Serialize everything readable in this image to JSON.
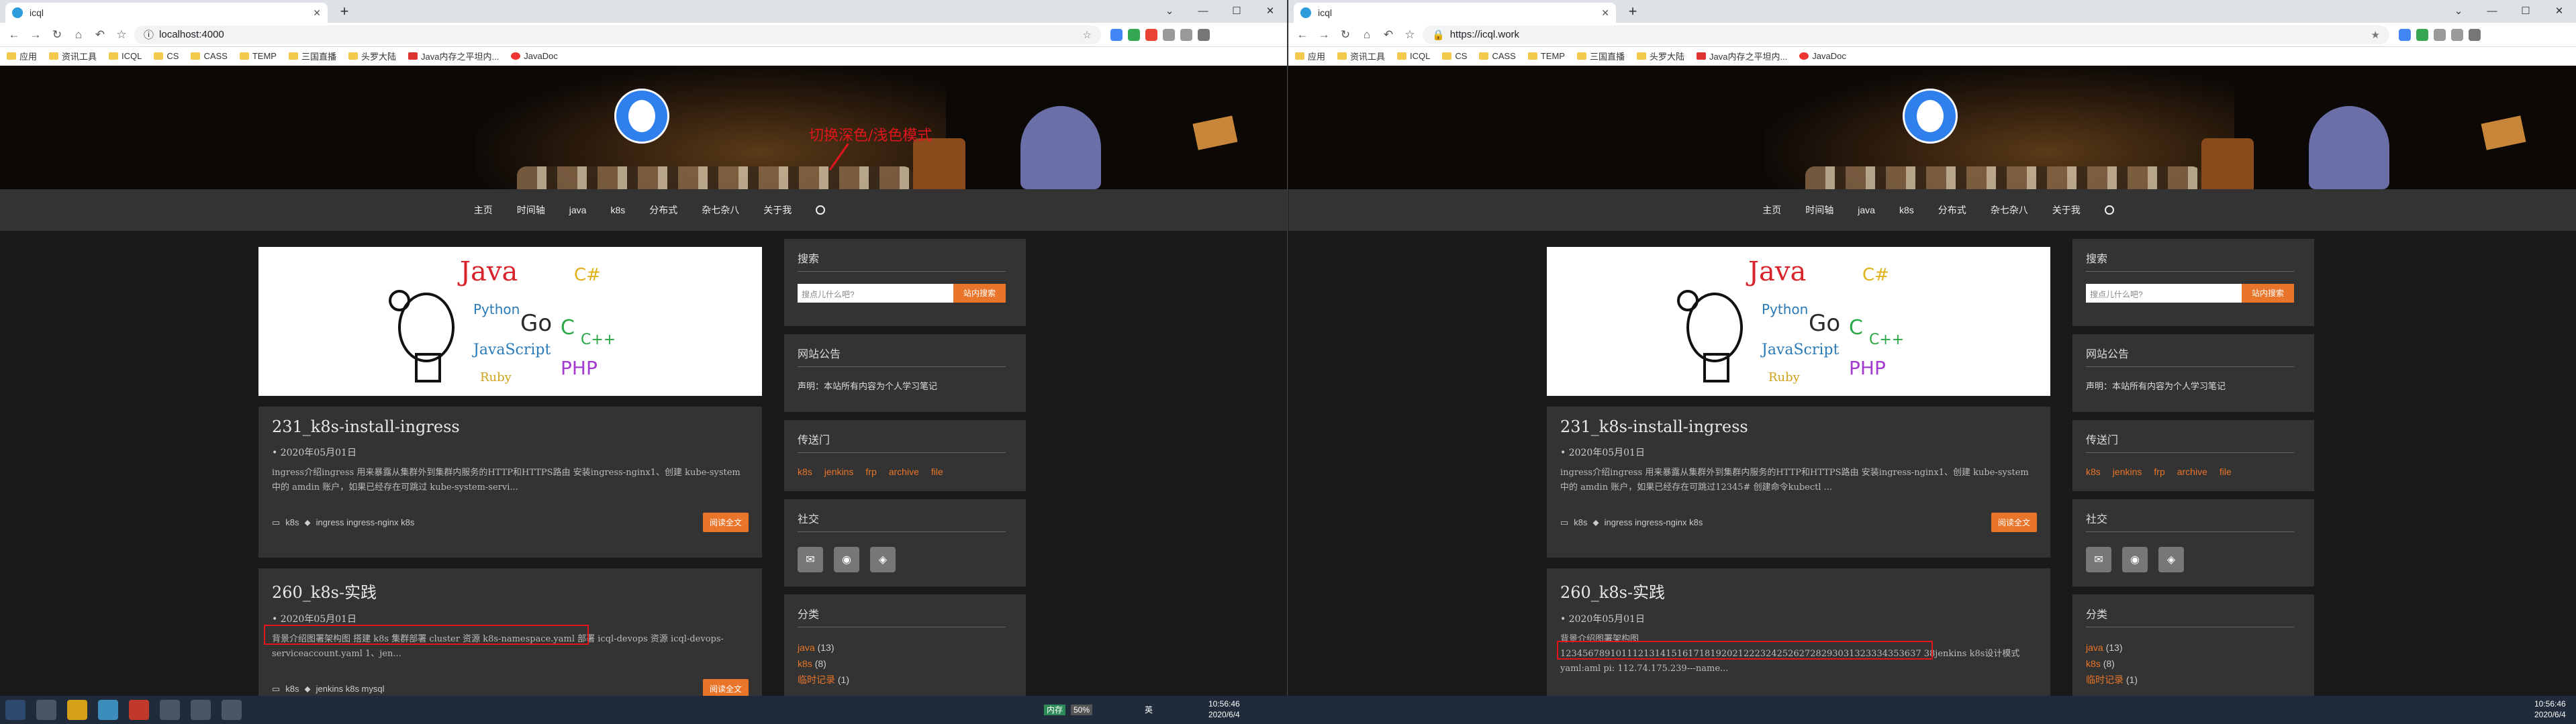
{
  "windows": [
    {
      "tab_title": "icql",
      "url": "localhost:4000",
      "bookmarks": [
        "应用",
        "资讯工具",
        "ICQL",
        "CS",
        "CASS",
        "TEMP",
        "三国直播",
        "头罗大陆",
        "Java内存之平坦内...",
        "JavaDoc"
      ],
      "annotation": "切换深色/浅色模式",
      "nav": [
        "主页",
        "时间轴",
        "java",
        "k8s",
        "分布式",
        "杂七杂八",
        "关于我"
      ],
      "posts": [
        {
          "title": "231_k8s-install-ingress",
          "date": "• 2020年05月01日",
          "excerpt": "ingress介绍ingress 用来暴露从集群外到集群内服务的HTTP和HTTPS路由 安装ingress-nginx1、创建 kube-system 中的 amdin 账户，如果已经存在可跳过 kube-system-servi...",
          "category": "k8s",
          "tags": "ingress  ingress-nginx  k8s",
          "read": "阅读全文"
        },
        {
          "title": "260_k8s-实践",
          "date": "• 2020年05月01日",
          "excerpt": "背景介绍图署架构图 搭建 k8s 集群部署 cluster 资源 k8s-namespace.yaml 部署 icql-devops 资源 icql-devops-serviceaccount.yaml 1、jen...",
          "category": "k8s",
          "tags": "jenkins  k8s  mysql",
          "read": "阅读全文"
        }
      ]
    },
    {
      "tab_title": "icql",
      "url": "https://icql.work",
      "bookmarks": [
        "应用",
        "资讯工具",
        "ICQL",
        "CS",
        "CASS",
        "TEMP",
        "三国直播",
        "头罗大陆",
        "Java内存之平坦内...",
        "JavaDoc"
      ],
      "annotation": "",
      "nav": [
        "主页",
        "时间轴",
        "java",
        "k8s",
        "分布式",
        "杂七杂八",
        "关于我"
      ],
      "posts": [
        {
          "title": "231_k8s-install-ingress",
          "date": "• 2020年05月01日",
          "excerpt": "ingress介绍ingress 用来暴露从集群外到集群内服务的HTTP和HTTPS路由 安装ingress-nginx1、创建 kube-system 中的 amdin 账户，如果已经存在可跳过12345# 创建命令kubectl ...",
          "category": "k8s",
          "tags": "ingress  ingress-nginx  k8s",
          "read": "阅读全文"
        },
        {
          "title": "260_k8s-实践",
          "date": "• 2020年05月01日",
          "excerpt": "背景介绍图署架构图",
          "excerpt2": "12345678910111213141516171819202122232425262728293031323334353637 38jenkins k8s设计模式yaml:aml pi: 112.74.175.239---name...",
          "category": "k8s",
          "tags": "jenkins  k8s  mysql",
          "read": "阅读全文"
        }
      ]
    }
  ],
  "sidebar": {
    "search_title": "搜索",
    "search_placeholder": "搜点儿什么吧?",
    "search_btn": "站内搜索",
    "notice_title": "网站公告",
    "notice_text": "声明：本站所有内容为个人学习笔记",
    "portal_title": "传送门",
    "portal_links": [
      "k8s",
      "jenkins",
      "frp",
      "archive",
      "file"
    ],
    "social_title": "社交",
    "cat_title": "分类",
    "cats": [
      {
        "name": "java",
        "count": "(13)"
      },
      {
        "name": "k8s",
        "count": "(8)"
      },
      {
        "name": "临时记录",
        "count": "(1)"
      }
    ]
  },
  "taskbar": {
    "time": "10:56:46",
    "date": "2020/6/4",
    "lang": "英",
    "cpu": "内存",
    "cpu_pct": "50%"
  }
}
